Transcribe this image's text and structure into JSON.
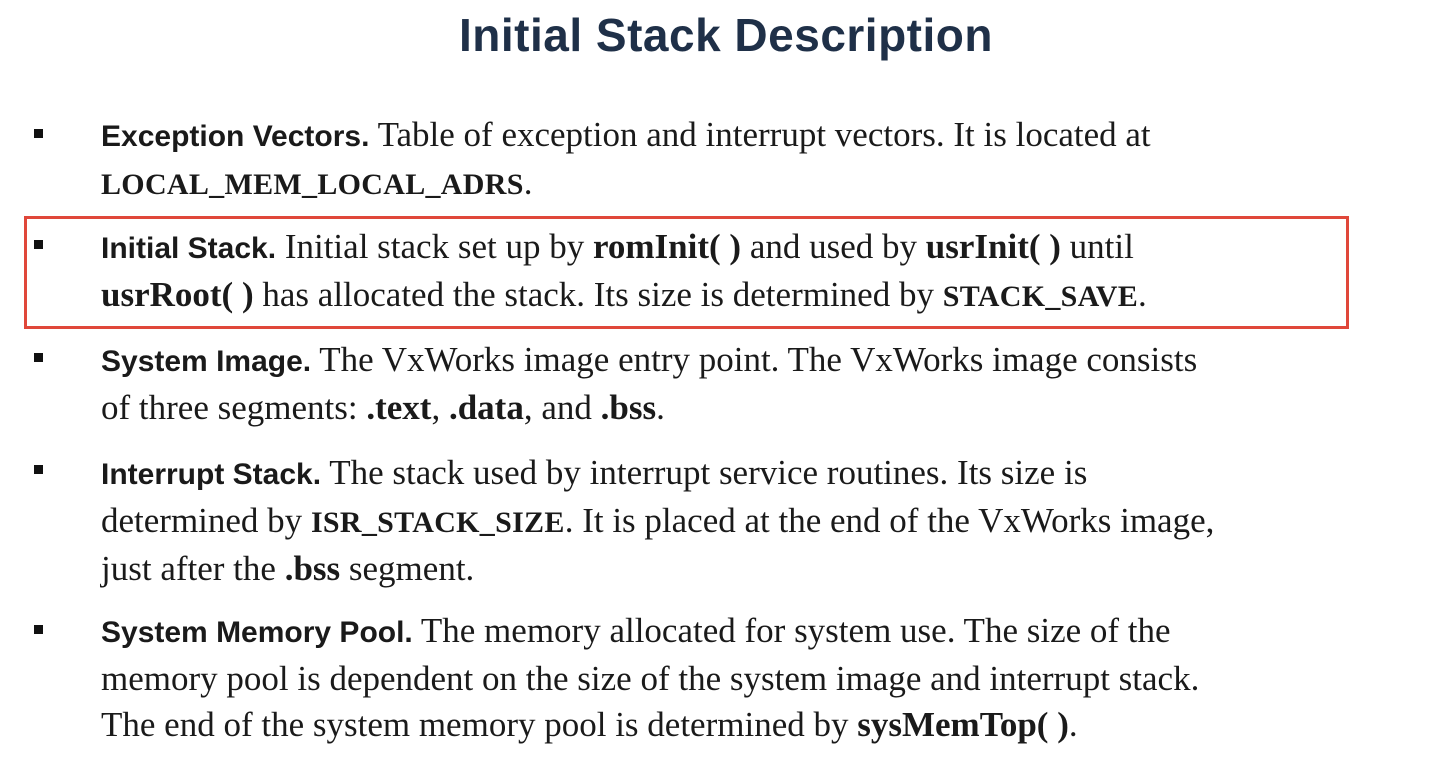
{
  "title": "Initial Stack Description",
  "items": [
    {
      "heading": "Exception Vectors.",
      "t1": "Table of exception and interrupt vectors. It is located at",
      "code1": "LOCAL_MEM_LOCAL_ADRS",
      "end": "."
    },
    {
      "heading": "Initial Stack.",
      "t1": "Initial stack set up by",
      "code1": "romInit( )",
      "t2": "and used by",
      "code2": "usrInit( )",
      "t3": "until",
      "code3": "usrRoot( )",
      "t4": "has allocated the stack. Its size is determined by",
      "code4": "STACK_SAVE",
      "end": "."
    },
    {
      "heading": "System Image.",
      "t1": "The VxWorks image entry point. The VxWorks image consists",
      "t2": "of three segments:",
      "code1": ".text",
      "sep1": ",",
      "code2": ".data",
      "sep2": ", and",
      "code3": ".bss",
      "end": "."
    },
    {
      "heading": "Interrupt Stack.",
      "t1": "The stack used by interrupt service routines. Its size is",
      "t2": "determined by",
      "code1": "ISR_STACK_SIZE",
      "t3": ". It is placed at the end of the VxWorks image,",
      "t4": "just after the",
      "code2": ".bss",
      "t5": "segment."
    },
    {
      "heading": "System Memory Pool.",
      "t1": "The memory allocated for system use. The size of the",
      "t2": "memory pool is dependent on the size of the system image and interrupt stack.",
      "t3": "The end of the system memory pool is determined by",
      "code1": "sysMemTop( )",
      "end": "."
    }
  ],
  "highlight_color": "#e0473a",
  "title_color": "#1f3048"
}
